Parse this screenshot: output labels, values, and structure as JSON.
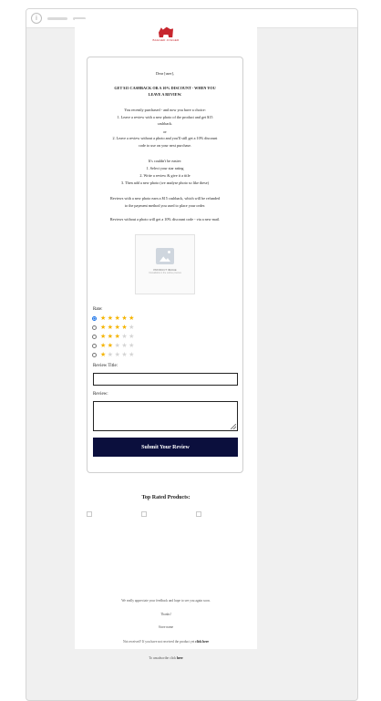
{
  "logo": {
    "brand_text": "BAGGED JOGGER"
  },
  "email": {
    "greeting": "Dear [user],",
    "headline_line1": "GET $15 CASHBACK OR A 10% DISCOUNT - WHEN YOU",
    "headline_line2": "LEAVE A REVIEW.",
    "intro": "You recently purchased - and now you have a choice:",
    "option1_line1": "1. Leave a review with a new photo of the product and get $15",
    "option1_line2": "cashback.",
    "or_text": "or",
    "option2_line1": "2. Leave a review without a photo and you'll still get a 10% discount",
    "option2_line2": "code to use on your next purchase.",
    "easy_text": "It's couldn't be easier:",
    "step1": "1. Select your star rating",
    "step2": "2. Write a review & give it a title",
    "step3": "3. Then add a new photo (we analyse photo so like these)",
    "cashback_line1": "Reviews with a new photo earn a $15 cashback, which will be refunded",
    "cashback_line2": "to the payment method you used to place your order.",
    "discount_line": "Reviews without a photo will get a 10% discount code - via a new mail."
  },
  "product_image": {
    "label": "PRODUCT IMAGE",
    "sublabel": "Unavailable in the outline preview"
  },
  "rating": {
    "label": "Rate:",
    "options": [
      {
        "stars": 5,
        "selected": true
      },
      {
        "stars": 4,
        "selected": false
      },
      {
        "stars": 3,
        "selected": false
      },
      {
        "stars": 2,
        "selected": false
      },
      {
        "stars": 1,
        "selected": false
      }
    ],
    "star_on_color": "#f5b400",
    "star_off_color": "#d5d5d5"
  },
  "review_title": {
    "label": "Review Title:",
    "value": "",
    "placeholder": ""
  },
  "review_body": {
    "label": "Review:",
    "value": "",
    "placeholder": ""
  },
  "submit_button": {
    "label": "Submit Your Review",
    "color": "#0b0f3d"
  },
  "top_rated": {
    "heading": "Top Rated Products:"
  },
  "footer": {
    "appreciate": "We really appreciate your feedback and hope to see you again soon.",
    "thanks": "Thanks!",
    "store": "Store name",
    "not_received_prefix": "Not received? If you have not received the product yet ",
    "not_received_link": "click here",
    "unsubscribe_prefix": "To unsubscribe click ",
    "unsubscribe_link": "here"
  },
  "icons": {
    "browser": "info-circle-icon",
    "logo": "bear-logo-icon"
  }
}
